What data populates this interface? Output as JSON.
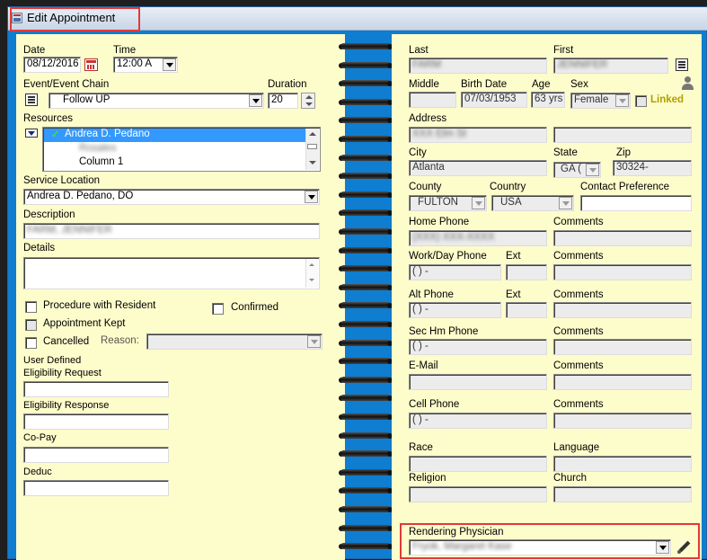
{
  "window": {
    "title": "Edit Appointment"
  },
  "left": {
    "date_label": "Date",
    "date_value": "08/12/2016",
    "time_label": "Time",
    "time_value": "12:00 A",
    "event_chain_label": "Event/Event Chain",
    "event_value": "Follow UP",
    "duration_label": "Duration",
    "duration_value": "20",
    "resources_label": "Resources",
    "resources": [
      "Andrea D. Pedano",
      "Rosales",
      "Column 1"
    ],
    "service_location_label": "Service Location",
    "service_location_value": "Andrea D. Pedano, DO",
    "description_label": "Description",
    "description_value": "FARM, JENNIFER",
    "details_label": "Details",
    "procedure_label": "Procedure with Resident",
    "confirmed_label": "Confirmed",
    "appointment_kept_label": "Appointment Kept",
    "cancelled_label": "Cancelled",
    "reason_label": "Reason:",
    "user_defined_label": "User Defined",
    "eligibility_request_label": "Eligibility Request",
    "eligibility_response_label": "Eligibility  Response",
    "copay_label": "Co-Pay",
    "deduc_label": "Deduc"
  },
  "right": {
    "last_label": "Last",
    "last_value": "FARM",
    "first_label": "First",
    "first_value": "JENNIFER",
    "middle_label": "Middle",
    "birth_date_label": "Birth Date",
    "birth_date_value": "07/03/1953",
    "age_label": "Age",
    "age_value": "63 yrs",
    "sex_label": "Sex",
    "sex_value": "Female",
    "linked_label": "Linked",
    "address_label": "Address",
    "address_value": "XXX Elm St",
    "city_label": "City",
    "city_value": "Atlanta",
    "state_label": "State",
    "state_value": "GA  (",
    "zip_label": "Zip",
    "zip_value": "30324-",
    "county_label": "County",
    "county_value": "FULTON",
    "country_label": "Country",
    "country_value": "USA",
    "contact_pref_label": "Contact Preference",
    "home_phone_label": "Home Phone",
    "home_phone_value": "(XXX) XXX-XXXX",
    "comments_label": "Comments",
    "work_phone_label": "Work/Day Phone",
    "ext_label": "Ext",
    "empty_phone": "(  )  -",
    "alt_phone_label": "Alt Phone",
    "sec_phone_label": "Sec Hm Phone",
    "email_label": "E-Mail",
    "cell_phone_label": "Cell Phone",
    "race_label": "Race",
    "language_label": "Language",
    "religion_label": "Religion",
    "church_label": "Church",
    "rendering_physician_label": "Rendering Physician",
    "rendering_physician_value": "Fryok, Margaret Kase"
  },
  "colors": {
    "panel_bg": "#fdfccb",
    "window_blue": "#0f7dd0",
    "highlight": "#e03a3a",
    "selection": "#3399ff",
    "linked": "#b0a000"
  }
}
